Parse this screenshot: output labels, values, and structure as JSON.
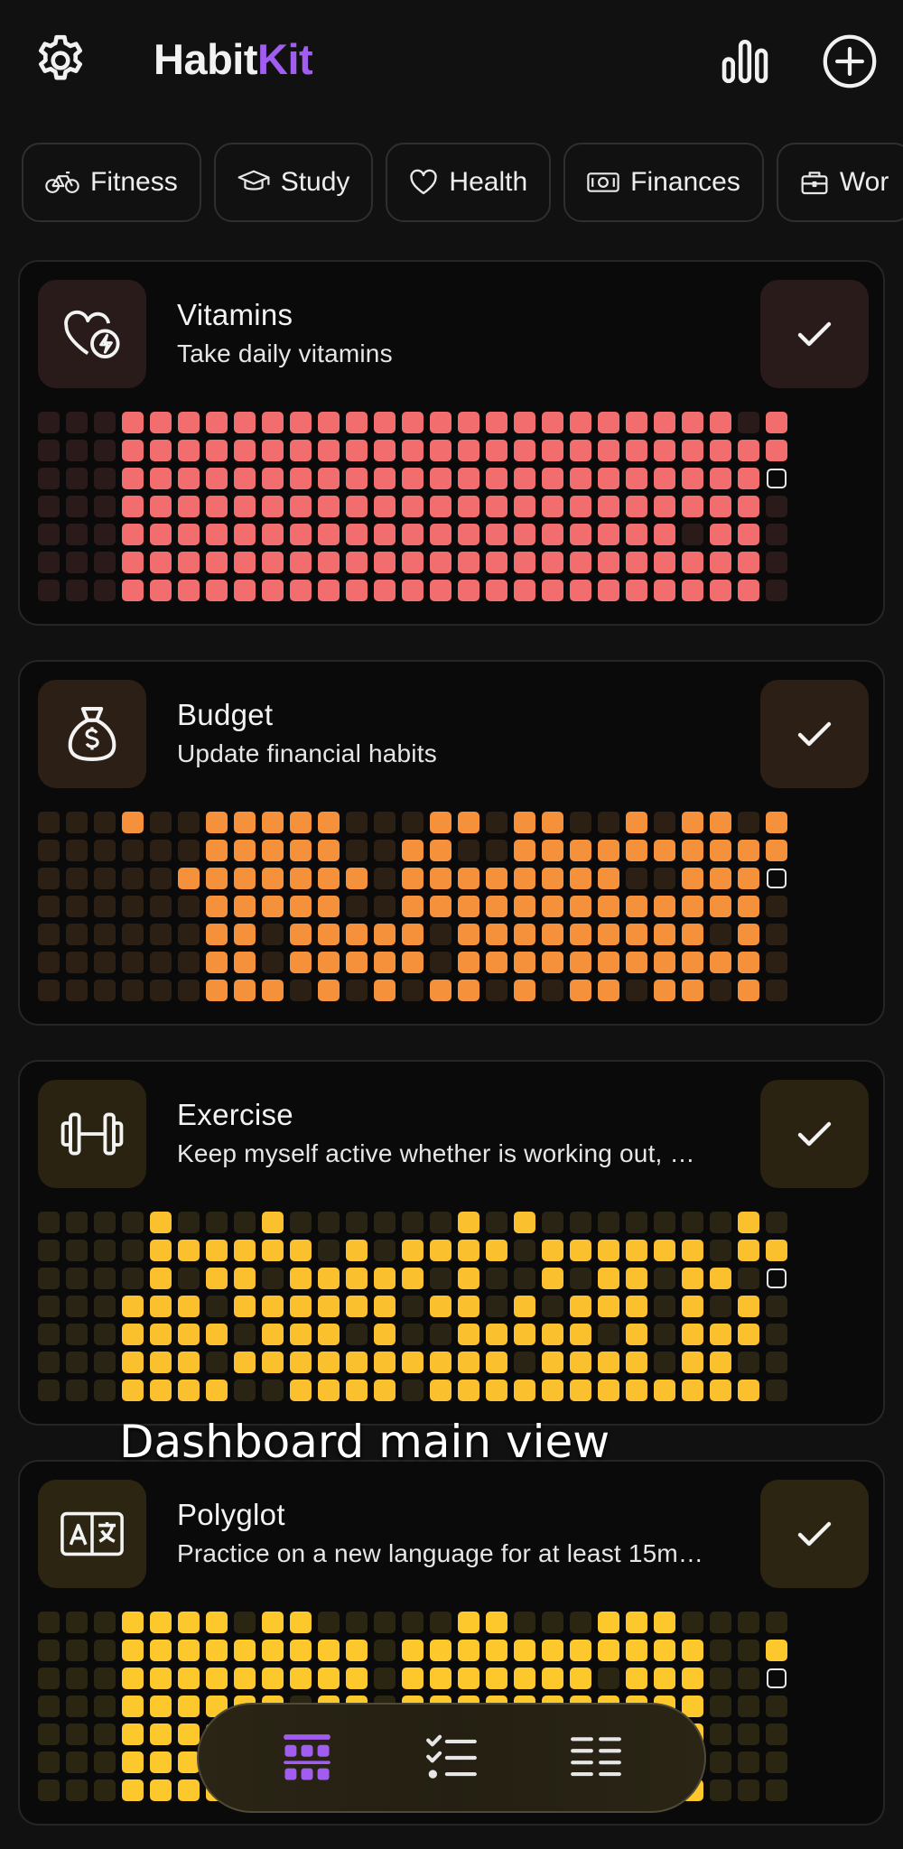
{
  "app": {
    "logo_main": "Habit",
    "logo_accent": "Kit",
    "accent_color": "#a15cf0"
  },
  "header": {
    "settings_icon": "gear-icon",
    "stats_icon": "bar-chart-icon",
    "add_icon": "plus-circle-icon"
  },
  "categories": [
    {
      "label": "Fitness",
      "icon": "bicycle-icon"
    },
    {
      "label": "Study",
      "icon": "graduation-cap-icon"
    },
    {
      "label": "Health",
      "icon": "heart-icon"
    },
    {
      "label": "Finances",
      "icon": "banknote-icon"
    },
    {
      "label": "Wor",
      "icon": "briefcase-icon"
    }
  ],
  "habits": [
    {
      "name": "Vitamins",
      "description": "Take daily vitamins",
      "icon": "heart-bolt-icon",
      "color": "#f26d6d",
      "dim_color": "#2b1a1a",
      "tile_color": "#2a1b1b",
      "grid": [
        "000111111111111111111111101",
        "000111111111111111111111111",
        "000111111111111111111111112",
        "000111111111111111111111110",
        "000111111111111111111110110",
        "000111111111111111111111110",
        "000111111111111111111111110"
      ]
    },
    {
      "name": "Budget",
      "description": "Update financial habits",
      "icon": "money-bag-icon",
      "color": "#f5913a",
      "dim_color": "#2c1f14",
      "tile_color": "#2b1f16",
      "grid": [
        "000100111110001101100101101",
        "000000111110011001111111111",
        "000001111111011111111001112",
        "000000111110011111111111110",
        "000000110111110111111111010",
        "000000110111110111111111110",
        "000000111010101101011011010"
      ]
    },
    {
      "name": "Exercise",
      "description": "Keep myself active whether is working out, …",
      "icon": "dumbbell-icon",
      "color": "#fbc02d",
      "dim_color": "#2a2414",
      "tile_color": "#2a2312",
      "grid": [
        "000010001000000101000000010",
        "000011111101011110111111011",
        "000010110111110100101101102",
        "000111011111101101011101010",
        "000111101110100111110101110",
        "000111011111111110111101100",
        "000111100111101111111111110"
      ]
    },
    {
      "name": "Polyglot",
      "description": "Practice on a new language for at least 15m…",
      "icon": "translate-icon",
      "color": "#fcc82c",
      "dim_color": "#2b2612",
      "tile_color": "#2b2512",
      "grid": [
        "000111101100000110001110000",
        "000111111111011111111111001",
        "000111111111011111110111002",
        "000111111011011111111111000",
        "000111111111111111111111000",
        "000111111111111111111111000",
        "000111111111111111111111000"
      ]
    }
  ],
  "caption": "Dashboard main view",
  "bottom_nav": [
    {
      "icon": "grid-view-icon",
      "active": true
    },
    {
      "icon": "checklist-icon",
      "active": false
    },
    {
      "icon": "list-view-icon",
      "active": false
    }
  ]
}
